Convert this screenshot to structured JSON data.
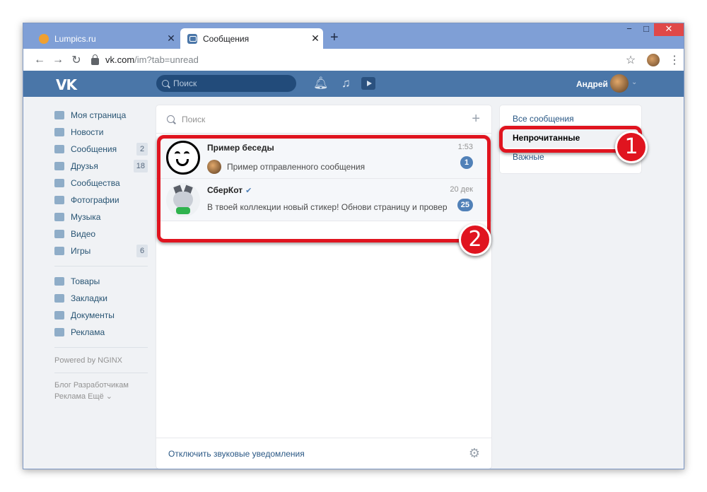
{
  "browser": {
    "tabs": [
      {
        "title": "Lumpics.ru",
        "active": false
      },
      {
        "title": "Сообщения",
        "active": true
      }
    ],
    "url_host": "vk.com",
    "url_path": "/im?tab=unread",
    "window_controls": {
      "minimize": "−",
      "maximize": "□",
      "close": "✕"
    }
  },
  "vk": {
    "logo": "VK",
    "search_placeholder": "Поиск",
    "user_name": "Андрей"
  },
  "left_menu": {
    "items": [
      {
        "label": "Моя страница",
        "badge": null,
        "icon": "home-icon"
      },
      {
        "label": "Новости",
        "badge": null,
        "icon": "news-icon"
      },
      {
        "label": "Сообщения",
        "badge": "2",
        "icon": "messages-icon"
      },
      {
        "label": "Друзья",
        "badge": "18",
        "icon": "friends-icon"
      },
      {
        "label": "Сообщества",
        "badge": null,
        "icon": "communities-icon"
      },
      {
        "label": "Фотографии",
        "badge": null,
        "icon": "photos-icon"
      },
      {
        "label": "Музыка",
        "badge": null,
        "icon": "music-icon"
      },
      {
        "label": "Видео",
        "badge": null,
        "icon": "video-icon"
      },
      {
        "label": "Игры",
        "badge": "6",
        "icon": "games-icon"
      }
    ],
    "items_secondary": [
      {
        "label": "Товары",
        "icon": "market-icon"
      },
      {
        "label": "Закладки",
        "icon": "bookmarks-icon"
      },
      {
        "label": "Документы",
        "icon": "documents-icon"
      },
      {
        "label": "Реклама",
        "icon": "ads-icon"
      }
    ],
    "powered": "Powered by NGINX",
    "footer_line1": "Блог   Разработчикам",
    "footer_line2": "Реклама   Ещё ⌄"
  },
  "dialogs": {
    "search_placeholder": "Поиск",
    "add_label": "+",
    "items": [
      {
        "name": "Пример беседы",
        "time": "1:53",
        "snippet": "Пример отправленного сообщения",
        "unread": "1"
      },
      {
        "name": "СберКот",
        "verified": "✔",
        "time": "20 дек",
        "snippet": "В твоей коллекции новый стикер! Обнови страницу и провер...",
        "unread": "25"
      }
    ],
    "mute_label": "Отключить звуковые уведомления"
  },
  "filters": {
    "all": "Все сообщения",
    "unread": "Непрочитанные",
    "important": "Важные"
  },
  "annotations": {
    "marker1": "1",
    "marker2": "2"
  },
  "colors": {
    "vk_blue": "#4a76a8",
    "highlight_red": "#e0141f",
    "badge_blue": "#5181b8"
  }
}
